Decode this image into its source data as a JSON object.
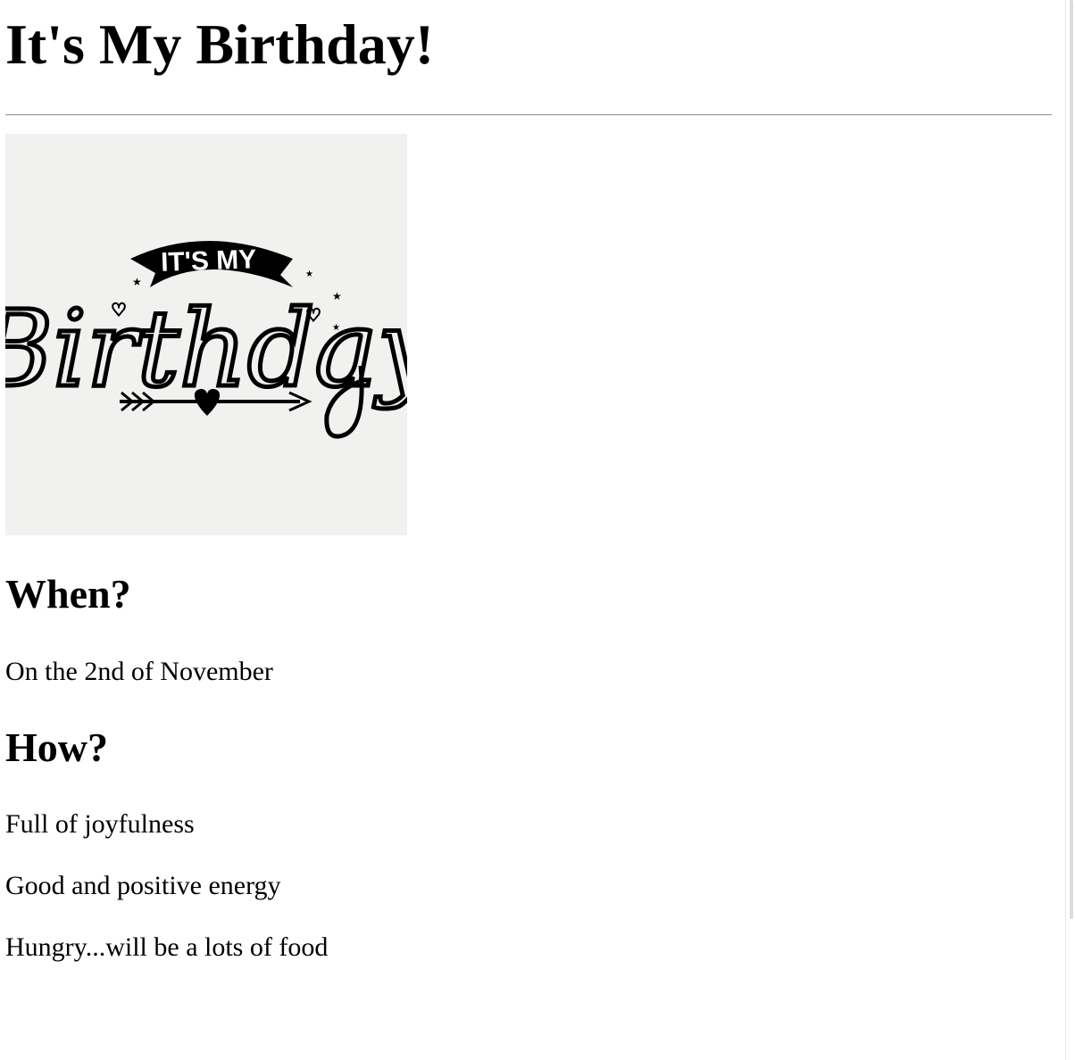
{
  "page": {
    "title": "It's My Birthday!"
  },
  "hero_image": {
    "banner_text": "IT'S MY",
    "script_text": "Birthday",
    "background_color": "#f1f1f0"
  },
  "sections": [
    {
      "heading": "When?",
      "paragraphs": [
        "On the 2nd of November"
      ]
    },
    {
      "heading": "How?",
      "paragraphs": [
        "Full of joyfulness",
        "Good and positive energy",
        "Hungry...will be a lots of food"
      ]
    }
  ]
}
